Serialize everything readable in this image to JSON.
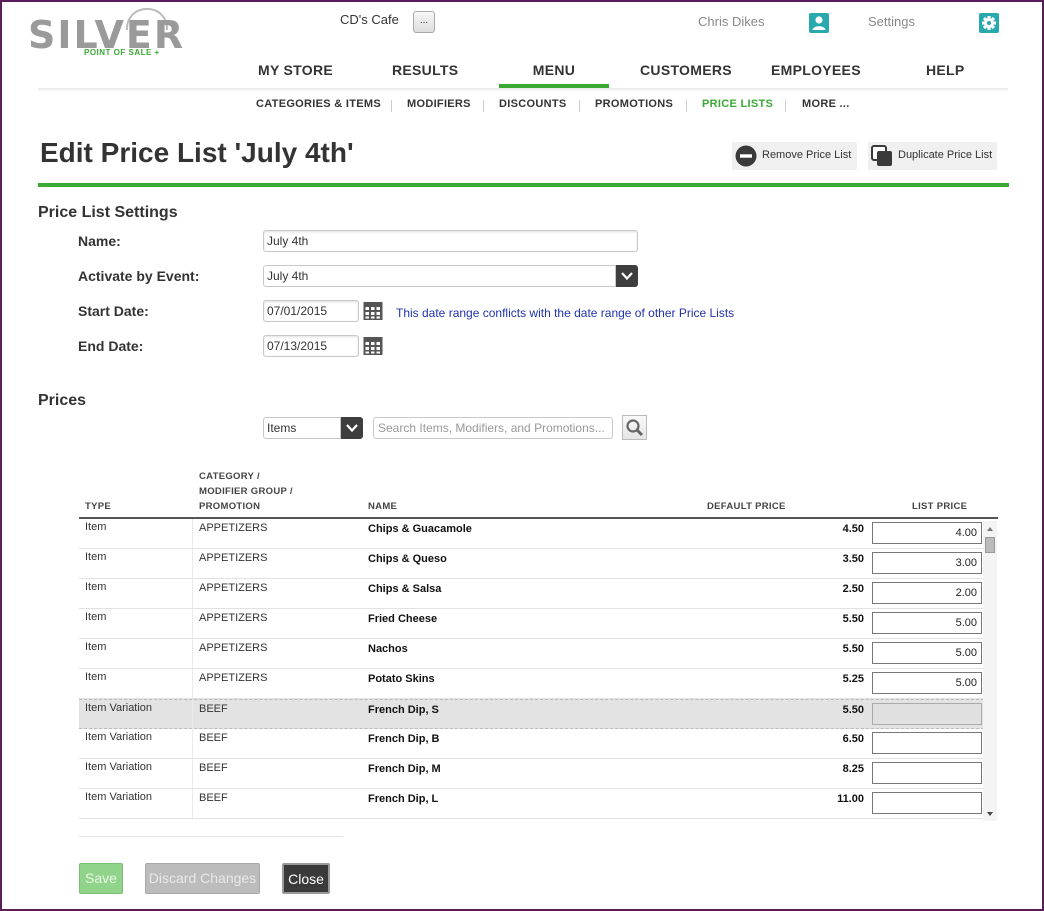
{
  "brand": {
    "name": "SILVER",
    "tagline": "POINT OF SALE +"
  },
  "header": {
    "store_name": "CD's Cafe",
    "store_button": "...",
    "user_name": "Chris Dikes",
    "settings_label": "Settings"
  },
  "main_nav": [
    "MY STORE",
    "RESULTS",
    "MENU",
    "CUSTOMERS",
    "EMPLOYEES",
    "HELP"
  ],
  "main_nav_active": "MENU",
  "sub_nav": [
    "CATEGORIES & ITEMS",
    "MODIFIERS",
    "DISCOUNTS",
    "PROMOTIONS",
    "PRICE LISTS",
    "MORE ..."
  ],
  "sub_nav_active": "PRICE LISTS",
  "page": {
    "title": "Edit Price List 'July 4th'",
    "remove_label": "Remove Price List",
    "duplicate_label": "Duplicate Price List"
  },
  "settings": {
    "section_title": "Price List Settings",
    "name_label": "Name:",
    "name_value": "July 4th",
    "event_label": "Activate by Event:",
    "event_value": "July 4th",
    "start_label": "Start Date:",
    "start_value": "07/01/2015",
    "end_label": "End Date:",
    "end_value": "07/13/2015",
    "conflict_message": "This date range conflicts with the date range of other Price Lists"
  },
  "prices": {
    "section_title": "Prices",
    "filter_value": "Items",
    "search_placeholder": "Search Items, Modifiers, and Promotions...",
    "columns": {
      "type": "TYPE",
      "category_1": "CATEGORY /",
      "category_2": "MODIFIER GROUP /",
      "category_3": "PROMOTION",
      "name": "NAME",
      "default_price": "DEFAULT PRICE",
      "list_price": "LIST PRICE"
    },
    "rows": [
      {
        "type": "Item",
        "category": "APPETIZERS",
        "name": "Chips & Guacamole",
        "default_price": "4.50",
        "list_price": "4.00"
      },
      {
        "type": "Item",
        "category": "APPETIZERS",
        "name": "Chips & Queso",
        "default_price": "3.50",
        "list_price": "3.00"
      },
      {
        "type": "Item",
        "category": "APPETIZERS",
        "name": "Chips & Salsa",
        "default_price": "2.50",
        "list_price": "2.00"
      },
      {
        "type": "Item",
        "category": "APPETIZERS",
        "name": "Fried Cheese",
        "default_price": "5.50",
        "list_price": "5.00"
      },
      {
        "type": "Item",
        "category": "APPETIZERS",
        "name": "Nachos",
        "default_price": "5.50",
        "list_price": "5.00"
      },
      {
        "type": "Item",
        "category": "APPETIZERS",
        "name": "Potato Skins",
        "default_price": "5.25",
        "list_price": "5.00"
      },
      {
        "type": "Item Variation",
        "category": "BEEF",
        "name": "French Dip, S",
        "default_price": "5.50",
        "list_price": "",
        "highlighted": true
      },
      {
        "type": "Item Variation",
        "category": "BEEF",
        "name": "French Dip, B",
        "default_price": "6.50",
        "list_price": ""
      },
      {
        "type": "Item Variation",
        "category": "BEEF",
        "name": "French Dip, M",
        "default_price": "8.25",
        "list_price": ""
      },
      {
        "type": "Item Variation",
        "category": "BEEF",
        "name": "French Dip, L",
        "default_price": "11.00",
        "list_price": ""
      }
    ]
  },
  "footer": {
    "save": "Save",
    "discard": "Discard Changes",
    "close": "Close"
  },
  "colors": {
    "accent": "#3aaa35",
    "teal": "#27a9ad",
    "link": "#2233aa",
    "frame": "#5a1f5a"
  }
}
